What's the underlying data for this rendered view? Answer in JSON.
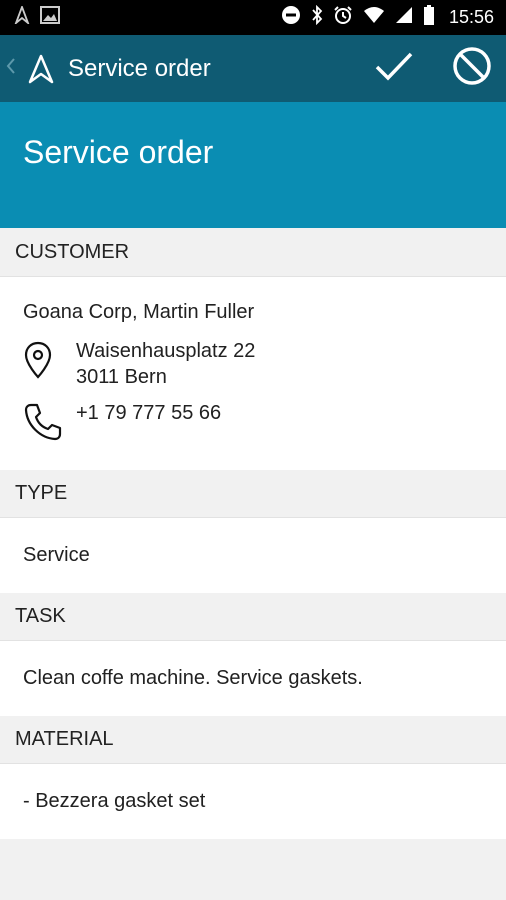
{
  "status_bar": {
    "time": "15:56"
  },
  "app_bar": {
    "title": "Service order"
  },
  "header": {
    "title": "Service order"
  },
  "sections": {
    "customer": {
      "heading": "CUSTOMER",
      "name": "Goana Corp, Martin Fuller",
      "address_line1": "Waisenhausplatz 22",
      "address_line2": "3011 Bern",
      "phone": "+1 79 777 55 66"
    },
    "type": {
      "heading": "TYPE",
      "value": "Service"
    },
    "task": {
      "heading": "TASK",
      "value": "Clean coffe machine. Service gaskets."
    },
    "material": {
      "heading": "MATERIAL",
      "value": "- Bezzera gasket set"
    }
  },
  "colors": {
    "appbar": "#0f5b73",
    "header": "#0a8db3",
    "background": "#f1f1f1"
  }
}
